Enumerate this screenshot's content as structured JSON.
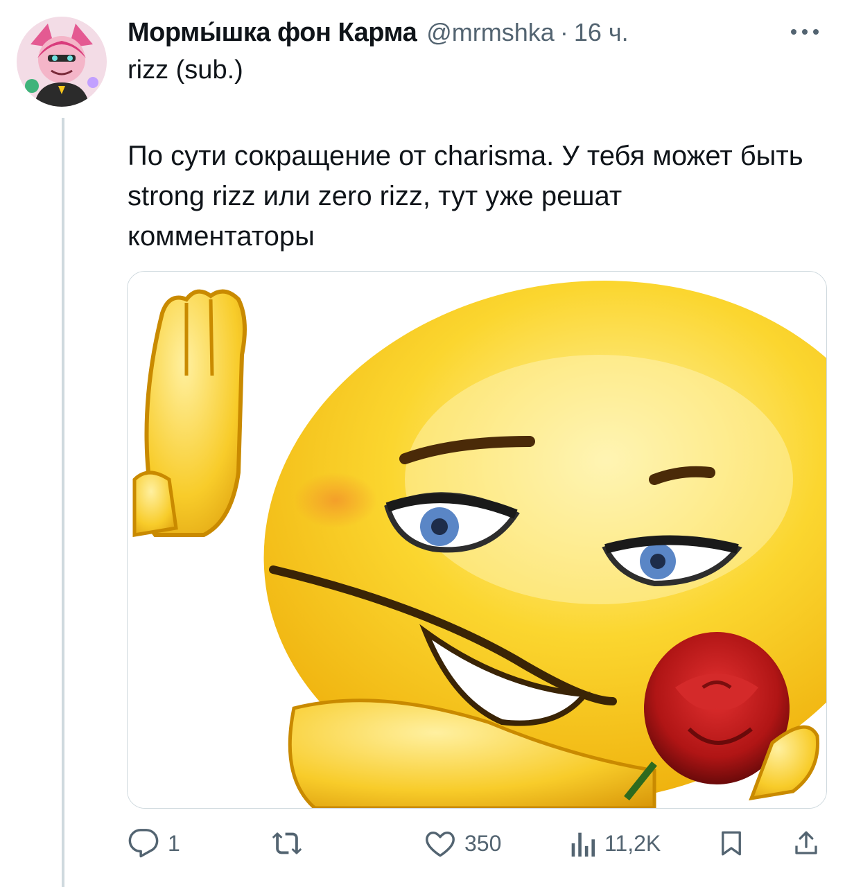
{
  "tweet": {
    "display_name": "Мормы́шка фон Карма",
    "handle": "@mrmshka",
    "separator": "·",
    "time": "16 ч.",
    "subtitle": "rizz (sub.)",
    "text": "По сути сокращение от charisma. У тебя может быть strong rizz или zero rizz, тут уже решат комментаторы"
  },
  "actions": {
    "replies": "1",
    "retweets": "",
    "likes": "350",
    "views": "11,2K"
  },
  "icons": {
    "more": "more-icon",
    "reply": "reply-icon",
    "retweet": "retweet-icon",
    "like": "heart-icon",
    "views": "views-icon",
    "bookmark": "bookmark-icon",
    "share": "share-icon"
  },
  "colors": {
    "text": "#0f1419",
    "secondary": "#536471",
    "border": "#cfd9de",
    "emoji_yellow": "#f7c51c",
    "rose_red": "#c81e1e"
  }
}
